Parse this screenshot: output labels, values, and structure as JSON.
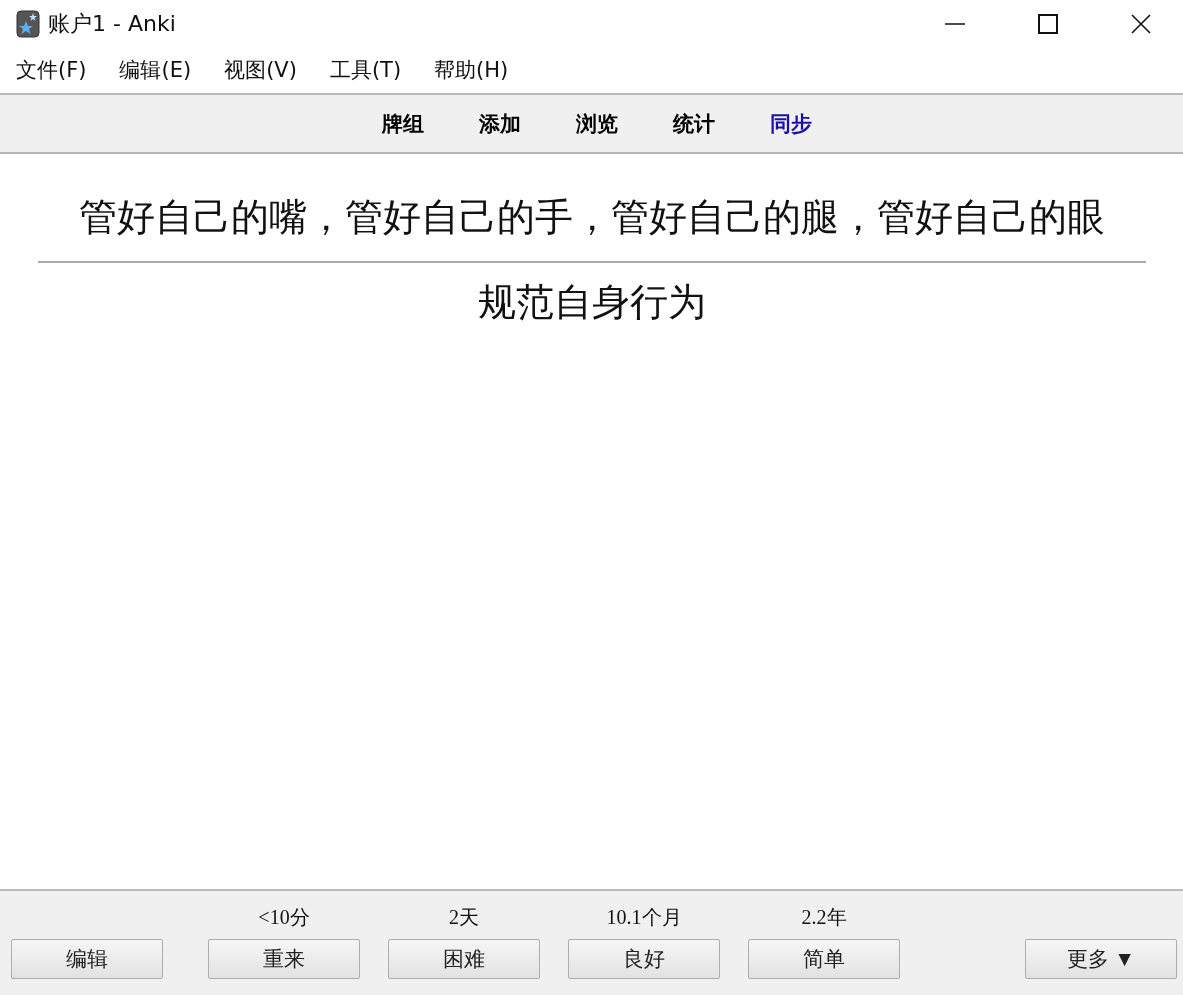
{
  "window": {
    "title": "账户1 - Anki"
  },
  "menu": [
    "文件(F)",
    "编辑(E)",
    "视图(V)",
    "工具(T)",
    "帮助(H)"
  ],
  "toolbar": [
    {
      "label": "牌组",
      "color": "#000000"
    },
    {
      "label": "添加",
      "color": "#000000"
    },
    {
      "label": "浏览",
      "color": "#000000"
    },
    {
      "label": "统计",
      "color": "#000000"
    },
    {
      "label": "同步",
      "color": "#1a0dab"
    }
  ],
  "card": {
    "question": "管好自己的嘴，管好自己的手，管好自己的腿，管好自己的眼",
    "answer": "规范自身行为"
  },
  "bottom_bar": {
    "edit_button": "编辑",
    "answers": [
      {
        "interval": "<10分",
        "label": "重来"
      },
      {
        "interval": "2天",
        "label": "困难"
      },
      {
        "interval": "10.1个月",
        "label": "良好"
      },
      {
        "interval": "2.2年",
        "label": "简单"
      }
    ],
    "more_button": "更多 ▼"
  }
}
